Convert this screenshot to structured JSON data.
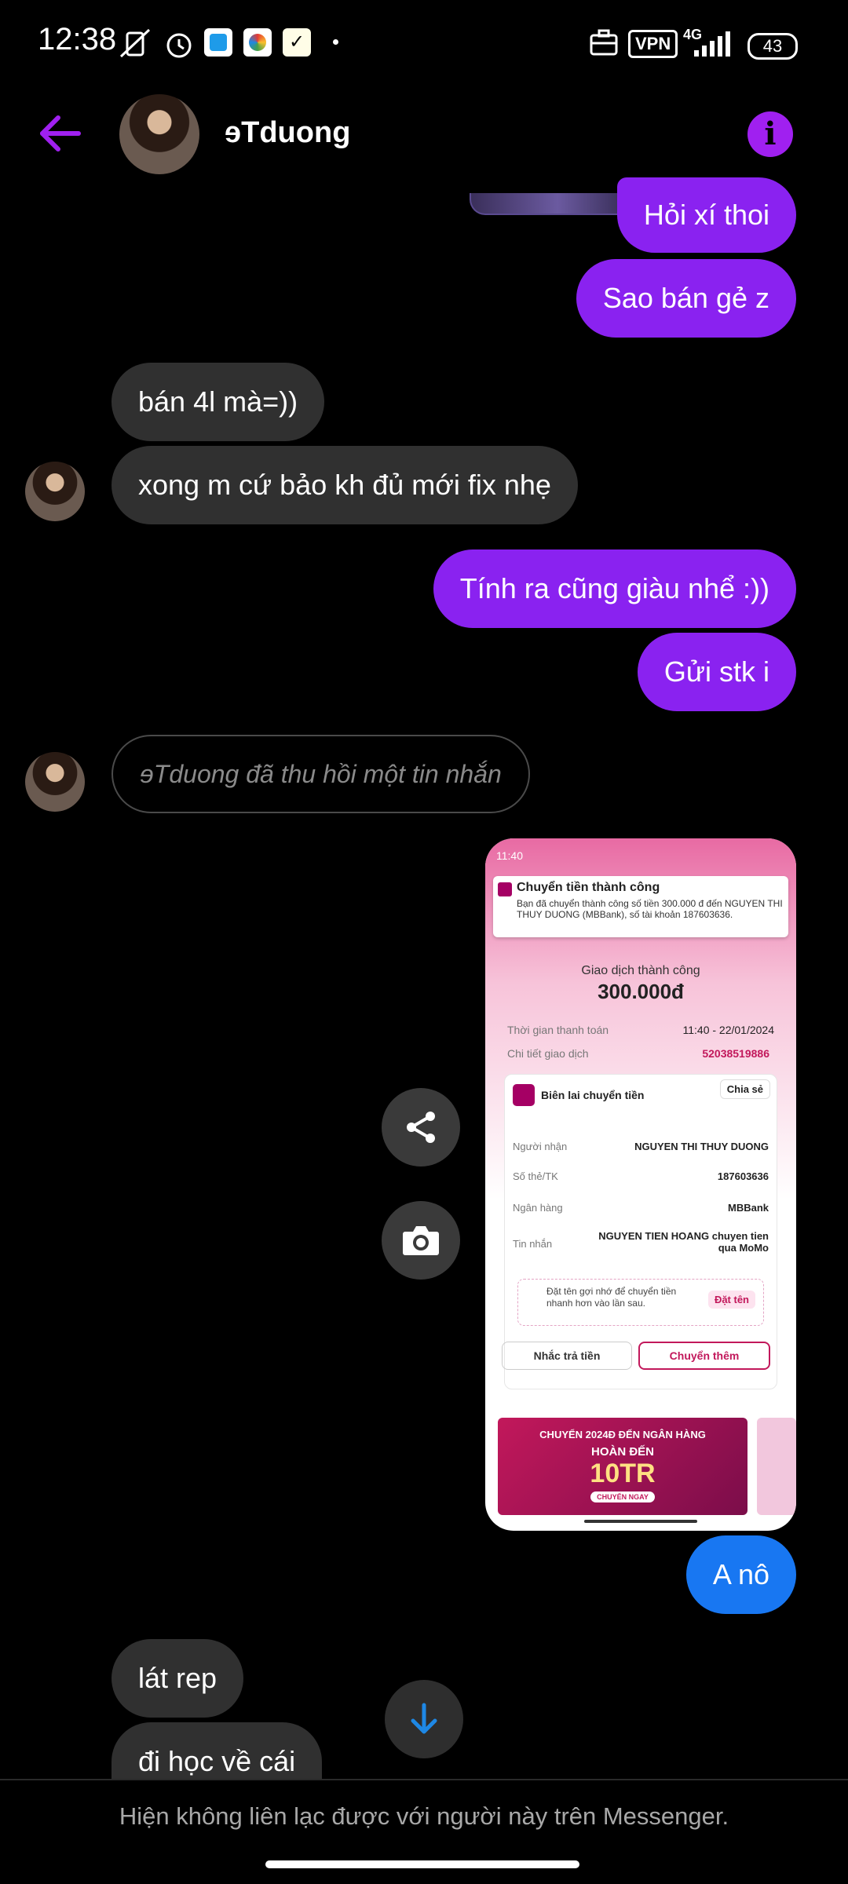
{
  "status_bar": {
    "time": "12:38",
    "vpn": "VPN",
    "network": "4G",
    "battery": "43"
  },
  "header": {
    "contact_name": "ɘTduong",
    "info_icon": "i"
  },
  "messages": [
    {
      "side": "out",
      "text": "Hỏi xí thoi"
    },
    {
      "side": "out",
      "text": "Sao bán gẻ z"
    },
    {
      "side": "in",
      "text": "bán 4l mà=))"
    },
    {
      "side": "in",
      "text": "xong m cứ bảo kh đủ mới fix nhẹ"
    },
    {
      "side": "out",
      "text": "Tính ra cũng giàu nhể :))"
    },
    {
      "side": "out",
      "text": "Gửi stk i"
    },
    {
      "side": "in",
      "text": "ɘTduong đã thu hồi một tin nhắn",
      "type": "revoked"
    },
    {
      "side": "out",
      "text": "A nô",
      "color": "#1877f2"
    },
    {
      "side": "in",
      "text": "lát rep"
    },
    {
      "side": "in",
      "text": "đi học về cái"
    }
  ],
  "momo_screenshot": {
    "status_time": "11:40",
    "notif_title": "Chuyển tiền thành công",
    "notif_body": "Bạn đã chuyển thành công số tiền 300.000 đ đến NGUYEN THI THUY DUONG (MBBank), số tài khoản 187603636.",
    "success_label": "Giao dịch thành công",
    "amount": "300.000đ",
    "time_label": "Thời gian thanh toán",
    "time_value": "11:40 - 22/01/2024",
    "detail_label": "Chi tiết giao dịch",
    "detail_value": "52038519886",
    "receipt_title": "Biên lai chuyển tiền",
    "share_label": "Chia sẻ",
    "rows": [
      {
        "label": "Người nhận",
        "value": "NGUYEN THI THUY DUONG"
      },
      {
        "label": "Số thẻ/TK",
        "value": "187603636"
      },
      {
        "label": "Ngân hàng",
        "value": "MBBank"
      },
      {
        "label": "Tin nhắn",
        "value": "NGUYEN TIEN HOANG chuyen tien qua MoMo"
      }
    ],
    "hint_text": "Đặt tên gợi nhớ để chuyển tiền nhanh hơn vào lần sau.",
    "name_button": "Đặt tên",
    "remind_button": "Nhắc trả tiền",
    "transfer_more_button": "Chuyển thêm",
    "banner_line1": "CHUYỂN 2024Đ ĐẾN NGÂN HÀNG",
    "banner_line2": "HOÀN ĐẾN",
    "banner_line3": "10TR",
    "banner_cta": "CHUYỂN NGAY"
  },
  "footer": {
    "notice": "Hiện không liên lạc được với người này trên Messenger."
  },
  "colors": {
    "accent": "#8a22f0",
    "incoming": "#303030",
    "blue_bubble": "#1877f2"
  }
}
